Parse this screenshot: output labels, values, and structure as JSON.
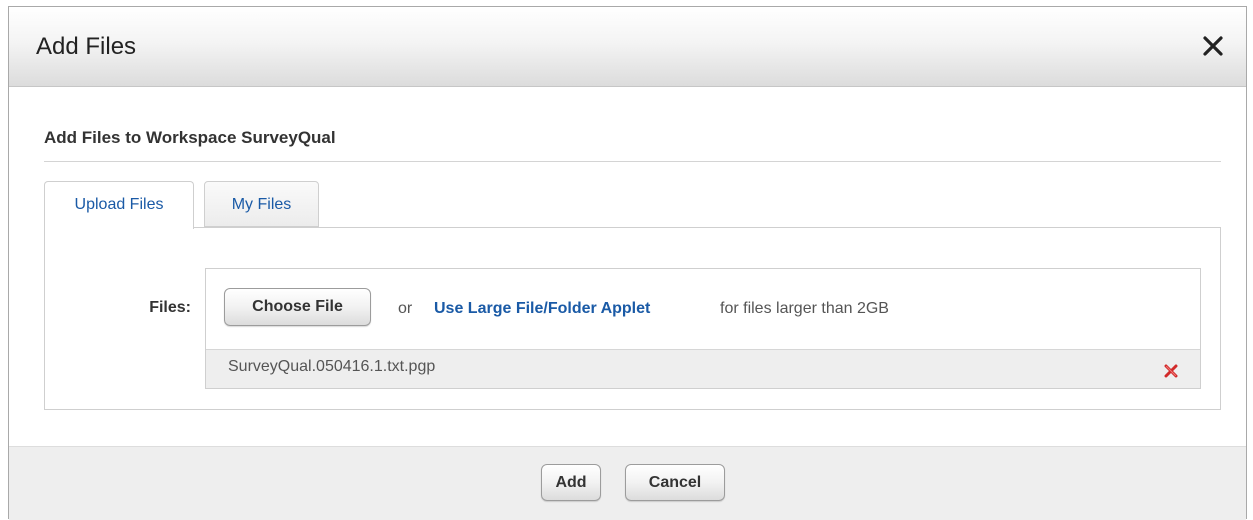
{
  "dialog": {
    "title": "Add Files",
    "close_icon": "close-icon"
  },
  "section": {
    "heading": "Add Files to Workspace SurveyQual"
  },
  "tabs": [
    {
      "label": "Upload Files",
      "active": true
    },
    {
      "label": "My Files",
      "active": false
    }
  ],
  "upload": {
    "files_label": "Files:",
    "choose_button": "Choose File",
    "or_text": "or",
    "applet_link": "Use Large File/Folder Applet",
    "applet_suffix": "for files larger than 2GB",
    "selected_files": [
      {
        "name": "SurveyQual.050416.1.txt.pgp",
        "remove_icon": "remove-icon"
      }
    ]
  },
  "footer": {
    "add_label": "Add",
    "cancel_label": "Cancel"
  },
  "colors": {
    "link": "#1a5aa6",
    "remove": "#d22a2a",
    "footer_bg": "#eeeeee"
  }
}
